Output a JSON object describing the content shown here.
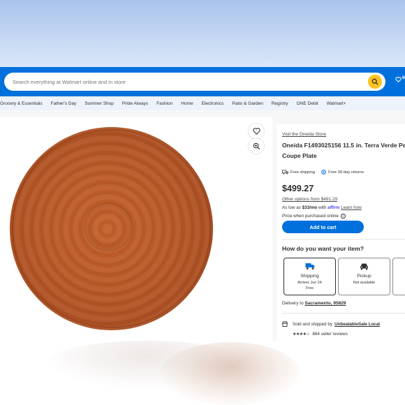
{
  "header": {
    "search_placeholder": "Search everything at Walmart online and in store",
    "right_label": "M"
  },
  "nav": {
    "items": [
      "Grocery & Essentials",
      "Father's Day",
      "Summer Shop",
      "Pride Always",
      "Fashion",
      "Home",
      "Electronics",
      "Patio & Garden",
      "Registry",
      "ONE Debit",
      "Walmart+"
    ]
  },
  "product": {
    "store_link": "Visit the Oneida Store",
    "title_line1": "Oneida F1493025156 11.5 in. Terra Verde Pe",
    "title_line2": "Coupe Plate",
    "free_shipping": "Free shipping",
    "free_returns": "Free 30-day returns",
    "price": "$499.27",
    "other_options": "Other options from $491.29",
    "affirm_prefix": "As low as",
    "affirm_amount": "$33/mo",
    "affirm_with": "with",
    "affirm_brand": "affirm",
    "affirm_learn": "Learn how",
    "online_note": "Price when purchased online",
    "add_to_cart": "Add to cart"
  },
  "fulfillment": {
    "question": "How do you want your item?",
    "options": [
      {
        "title": "Shipping",
        "line1": "Arrives Jun 24",
        "line2": "Free"
      },
      {
        "title": "Pickup",
        "line1": "Not available",
        "line2": ""
      }
    ],
    "delivery_prefix": "Delivery to",
    "delivery_location": "Sacramento, 95829"
  },
  "seller": {
    "sold_prefix": "Sold and shipped by",
    "seller_name": "UnbeatableSale Local",
    "rating_stars": "★★★★☆",
    "rating": 4,
    "reviews": "864 seller reviews"
  },
  "colors": {
    "header_blue": "#0071dc",
    "spark_yellow": "#ffc220",
    "plate_terracotta": "#b15324"
  }
}
